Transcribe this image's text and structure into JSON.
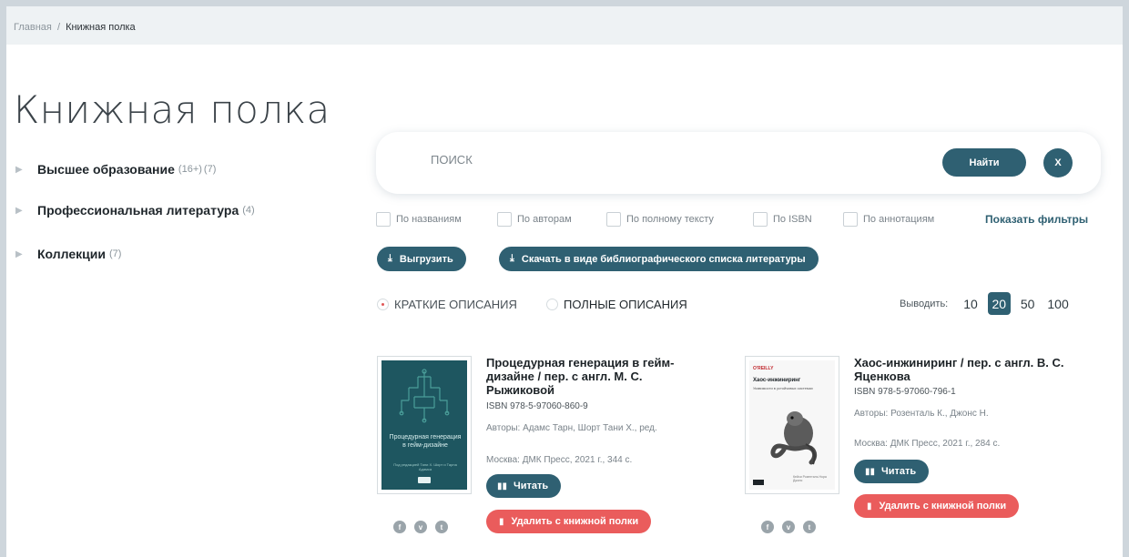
{
  "breadcrumb": {
    "home": "Главная",
    "separator": "/",
    "current": "Книжная полка"
  },
  "page_title": "Книжная полка",
  "categories": [
    {
      "name": "Высшее образование",
      "age": "(16+)",
      "count": "(7)"
    },
    {
      "name": "Профессиональная литература",
      "count": "(4)"
    },
    {
      "name": "Коллекции",
      "count": "(7)"
    }
  ],
  "search": {
    "placeholder": "ПОИСК",
    "find_label": "Найти",
    "clear_label": "X"
  },
  "filters": [
    {
      "label": "По названиям"
    },
    {
      "label": "По авторам"
    },
    {
      "label": "По полному тексту"
    },
    {
      "label": "По ISBN"
    },
    {
      "label": "По аннотациям"
    }
  ],
  "show_filters_label": "Показать фильтры",
  "actions": {
    "export_label": "Выгрузить",
    "bib_label": "Скачать в виде библиографического списка литературы"
  },
  "view": {
    "brief": "КРАТКИЕ ОПИСАНИЯ",
    "full": "ПОЛНЫЕ ОПИСАНИЯ",
    "selected": "brief"
  },
  "per_page": {
    "label": "Выводить:",
    "options": [
      "10",
      "20",
      "50",
      "100"
    ],
    "selected": "20"
  },
  "books": [
    {
      "title": "Процедурная генерация в гейм-дизайне / пер. с англ. М. С. Рыжиковой",
      "isbn": "ISBN 978-5-97060-860-9",
      "authors": "Авторы: Адамс Тарн, Шорт Тани Х., ред.",
      "imprint": "Москва: ДМК Пресс, 2021 г., 344 с.",
      "cover_text": "Процедурная генерация в гейм-дизайне",
      "cover_subtext": "Под редакцией Тани Х. Шорт и Тарна Адамса",
      "read_label": "Читать",
      "delete_label": "Удалить с книжной полки"
    },
    {
      "title": "Хаос-инжиниринг / пер. с англ. В. С. Яценкова",
      "isbn": "ISBN 978-5-97060-796-1",
      "authors": "Авторы: Розенталь К., Джонс Н.",
      "imprint": "Москва: ДМК Пресс, 2021 г., 284 с.",
      "cover_publisher": "O'REILLY",
      "cover_text": "Хаос-инжиниринг",
      "cover_subtext": "Уязвимости в устойчивых системах",
      "cover_authors": "Кейси Розенталь Нора Джонс",
      "read_label": "Читать",
      "delete_label": "Удалить с книжной полки"
    }
  ],
  "colors": {
    "primary": "#2f6072",
    "danger": "#ea5c5c",
    "breadcrumb_bg": "#eef2f4",
    "page_bg": "#ced6dc"
  }
}
